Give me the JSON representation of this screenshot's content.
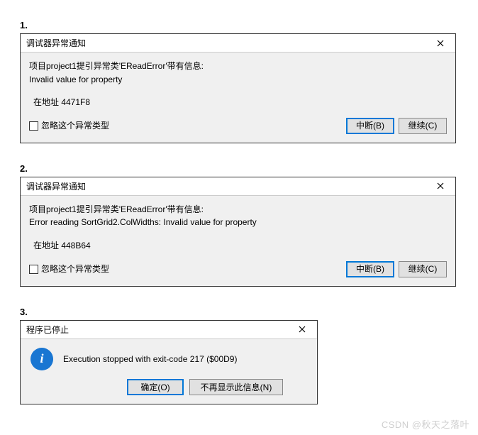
{
  "sections": {
    "s1": "1.",
    "s2": "2.",
    "s3": "3."
  },
  "dialog1": {
    "title": "调试器异常通知",
    "line1": "项目project1提引异常类'EReadError'带有信息:",
    "line2": "Invalid value for property",
    "addr": "在地址 4471F8",
    "ignore": "忽略这个异常类型",
    "break": "中断(B)",
    "cont": "继续(C)"
  },
  "dialog2": {
    "title": "调试器异常通知",
    "line1": "项目project1提引异常类'EReadError'带有信息:",
    "line2": "Error reading SortGrid2.ColWidths: Invalid value for property",
    "addr": "在地址 448B64",
    "ignore": "忽略这个异常类型",
    "break": "中断(B)",
    "cont": "继续(C)"
  },
  "dialog3": {
    "title": "程序已停止",
    "msg": "Execution stopped with exit-code 217 ($00D9)",
    "ok": "确定(O)",
    "noshow": "不再显示此信息(N)",
    "icon_glyph": "i"
  },
  "watermark": "CSDN @秋天之落叶"
}
